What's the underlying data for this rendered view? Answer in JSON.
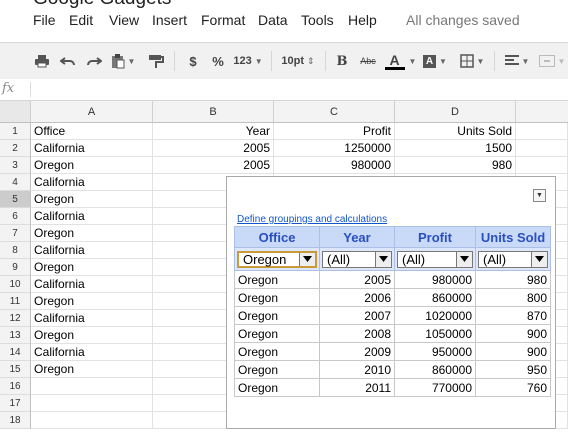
{
  "doc": {
    "title": "Google Gadgets"
  },
  "menu": {
    "items": [
      "File",
      "Edit",
      "View",
      "Insert",
      "Format",
      "Data",
      "Tools",
      "Help"
    ],
    "status": "All changes saved"
  },
  "toolbar": {
    "currency": "$",
    "percent": "%",
    "number_format": "123",
    "font_size": "10pt",
    "bold": "B",
    "strike": "Abc",
    "text_color_letter": "A",
    "fill_color_letter": "A",
    "text_color": "#000000"
  },
  "formula_bar": {
    "fx": "fx",
    "content": ""
  },
  "columns": [
    "A",
    "B",
    "C",
    "D"
  ],
  "selected_row": 5,
  "rows": [
    {
      "n": "1",
      "a": "Office",
      "b": "Year",
      "c": "Profit",
      "d": "Units Sold"
    },
    {
      "n": "2",
      "a": "California",
      "b": "2005",
      "c": "1250000",
      "d": "1500"
    },
    {
      "n": "3",
      "a": "Oregon",
      "b": "2005",
      "c": "980000",
      "d": "980"
    },
    {
      "n": "4",
      "a": "California",
      "b": "",
      "c": "",
      "d": ""
    },
    {
      "n": "5",
      "a": "Oregon",
      "b": "",
      "c": "",
      "d": ""
    },
    {
      "n": "6",
      "a": "California",
      "b": "",
      "c": "",
      "d": ""
    },
    {
      "n": "7",
      "a": "Oregon",
      "b": "",
      "c": "",
      "d": ""
    },
    {
      "n": "8",
      "a": "California",
      "b": "",
      "c": "",
      "d": ""
    },
    {
      "n": "9",
      "a": "Oregon",
      "b": "",
      "c": "",
      "d": ""
    },
    {
      "n": "10",
      "a": "California",
      "b": "",
      "c": "",
      "d": ""
    },
    {
      "n": "11",
      "a": "Oregon",
      "b": "",
      "c": "",
      "d": ""
    },
    {
      "n": "12",
      "a": "California",
      "b": "",
      "c": "",
      "d": ""
    },
    {
      "n": "13",
      "a": "Oregon",
      "b": "",
      "c": "",
      "d": ""
    },
    {
      "n": "14",
      "a": "California",
      "b": "",
      "c": "",
      "d": ""
    },
    {
      "n": "15",
      "a": "Oregon",
      "b": "",
      "c": "",
      "d": ""
    },
    {
      "n": "16",
      "a": "",
      "b": "",
      "c": "",
      "d": ""
    },
    {
      "n": "17",
      "a": "",
      "b": "",
      "c": "",
      "d": ""
    },
    {
      "n": "18",
      "a": "",
      "b": "",
      "c": "",
      "d": ""
    }
  ],
  "gadget": {
    "link": "Define groupings and calculations",
    "headers": [
      "Office",
      "Year",
      "Profit",
      "Units Sold"
    ],
    "filters": [
      "Oregon",
      "(All)",
      "(All)",
      "(All)"
    ],
    "rows": [
      [
        "Oregon",
        "2005",
        "980000",
        "980"
      ],
      [
        "Oregon",
        "2006",
        "860000",
        "800"
      ],
      [
        "Oregon",
        "2007",
        "1020000",
        "870"
      ],
      [
        "Oregon",
        "2008",
        "1050000",
        "900"
      ],
      [
        "Oregon",
        "2009",
        "950000",
        "900"
      ],
      [
        "Oregon",
        "2010",
        "860000",
        "950"
      ],
      [
        "Oregon",
        "2011",
        "770000",
        "760"
      ]
    ]
  }
}
